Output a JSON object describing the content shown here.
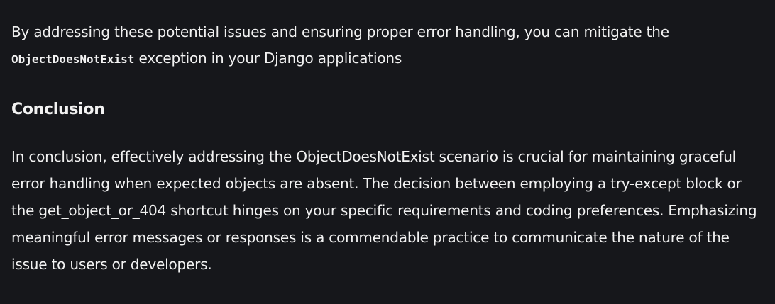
{
  "intro": {
    "text_before": "By addressing these potential issues and ensuring proper error handling, you can mitigate the",
    "code": "ObjectDoesNotExist",
    "text_after": " exception in your Django applications"
  },
  "conclusion": {
    "heading": "Conclusion",
    "body": "In conclusion, effectively addressing the ObjectDoesNotExist scenario is crucial for maintaining graceful error handling when expected objects are absent. The decision between employing a try-except block or the get_object_or_404 shortcut hinges on your specific requirements and coding preferences. Emphasizing meaningful error messages or responses is a commendable practice to communicate the nature of the issue to users or developers."
  }
}
